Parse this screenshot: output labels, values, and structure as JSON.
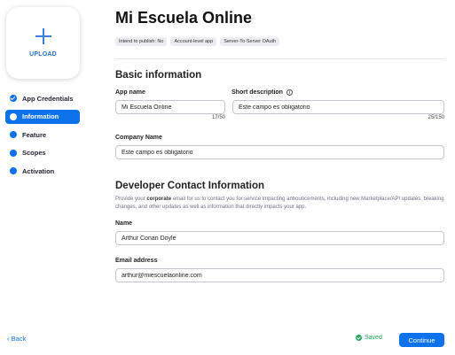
{
  "upload": {
    "label": "UPLOAD",
    "icon": "plus-icon"
  },
  "nav": {
    "items": [
      {
        "label": "App Credentials",
        "state": "completed"
      },
      {
        "label": "Information",
        "state": "active"
      },
      {
        "label": "Feature",
        "state": "pending"
      },
      {
        "label": "Scopes",
        "state": "pending"
      },
      {
        "label": "Activation",
        "state": "pending"
      }
    ]
  },
  "header": {
    "title": "Mi Escuela Online",
    "badges": [
      "Intend to publish: No",
      "Account-level app",
      "Server-To-Server OAuth"
    ]
  },
  "basic": {
    "title": "Basic information",
    "app_name": {
      "label": "App name",
      "value": "Mi Escuela Online",
      "counter": "17/50"
    },
    "short_desc": {
      "label": "Short description",
      "value": "Este campo es obligatorio",
      "counter": "25/150",
      "info_icon": "info-icon"
    },
    "company": {
      "label": "Company Name",
      "value": "Este campo es obligatorio"
    }
  },
  "developer": {
    "title": "Developer Contact Information",
    "help_prefix": "Provide your ",
    "help_bold": "corporate",
    "help_suffix": " email for us to contact you for service impacting announcements, including new Marketplace/API updates, breaking changes, and other updates as well as information that directly impacts your app.",
    "name": {
      "label": "Name",
      "value": "Arthur Conan Doyle"
    },
    "email": {
      "label": "Email address",
      "value": "arthur@miescuelaonline.com"
    }
  },
  "footer": {
    "back": "‹  Back",
    "saved": "Saved",
    "continue": "Continue"
  },
  "colors": {
    "accent": "#0e72ed",
    "saved": "#1fa356",
    "badge_bg": "#ececf1"
  }
}
